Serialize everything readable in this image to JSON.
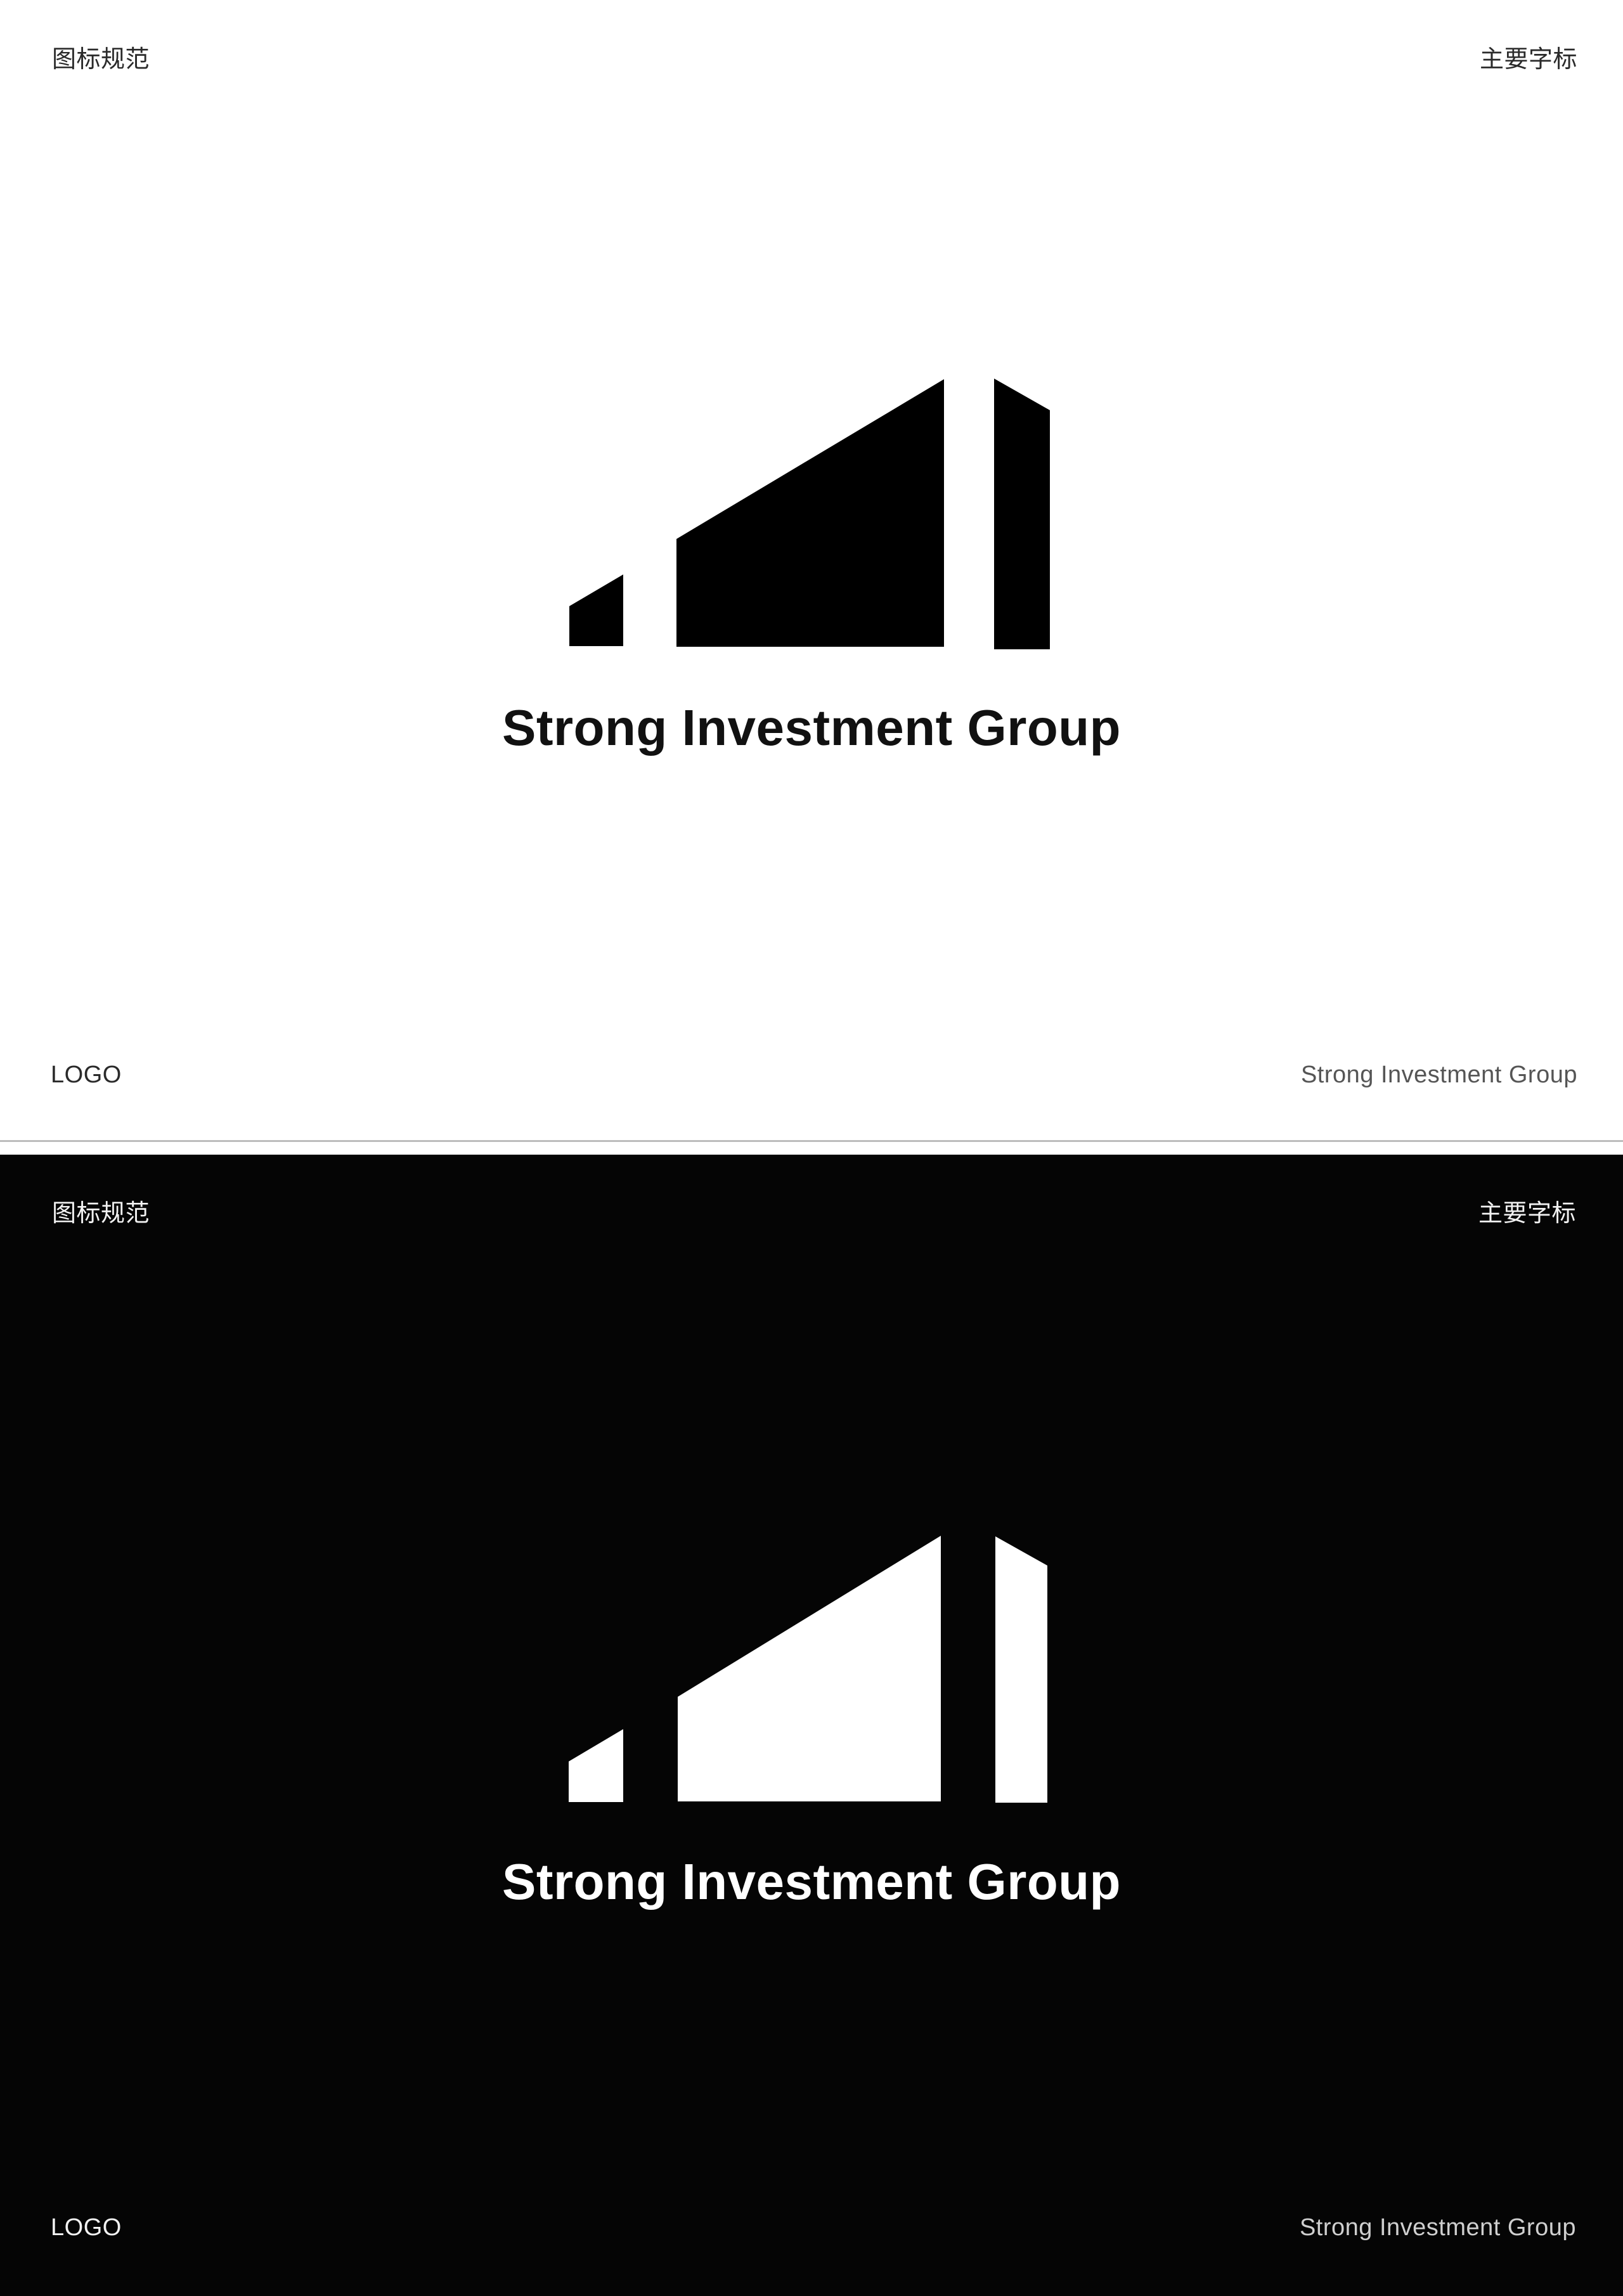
{
  "colors": {
    "light_background": "#ffffff",
    "light_mark": "#000000",
    "dark_background": "#050505",
    "dark_mark": "#ffffff",
    "divider": "#bdbdbd"
  },
  "light_panel": {
    "top_left_label": "图标规范",
    "top_right_label": "主要字标",
    "wordmark": "Strong Investment Group",
    "bottom_left_label": "LOGO",
    "bottom_right_label": "Strong Investment Group",
    "logo_icon": "ascending-bars-building-icon"
  },
  "dark_panel": {
    "top_left_label": "图标规范",
    "top_right_label": "主要字标",
    "wordmark": "Strong Investment Group",
    "bottom_left_label": "LOGO",
    "bottom_right_label": "Strong Investment Group",
    "logo_icon": "ascending-bars-building-icon"
  }
}
